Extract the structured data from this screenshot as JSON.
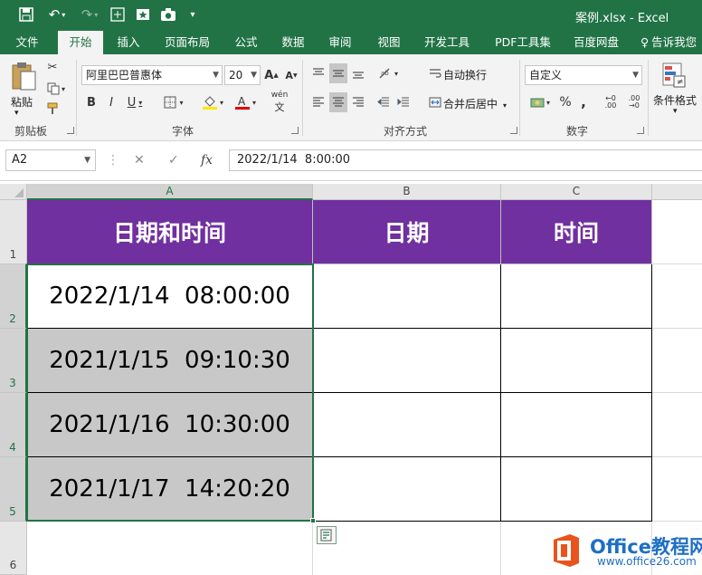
{
  "window": {
    "title": "案例.xlsx - Excel"
  },
  "ribbon_tabs": [
    "文件",
    "开始",
    "插入",
    "页面布局",
    "公式",
    "数据",
    "审阅",
    "视图",
    "开发工具",
    "PDF工具集",
    "百度网盘",
    "告诉我您"
  ],
  "clipboard": {
    "paste_label": "粘贴",
    "group_label": "剪贴板"
  },
  "font": {
    "name": "阿里巴巴普惠体",
    "size": "20",
    "group_label": "字体",
    "grow": "A",
    "shrink": "A",
    "bold": "B",
    "italic": "I",
    "underline": "U",
    "phonetic": "wén"
  },
  "alignment": {
    "wrap_text": "自动换行",
    "merge_center": "合并后居中",
    "group_label": "对齐方式"
  },
  "number": {
    "format": "自定义",
    "group_label": "数字",
    "percent": "%",
    "comma": ","
  },
  "styles": {
    "conditional_format": "条件格式"
  },
  "formula_bar": {
    "name_box": "A2",
    "fx": "fx",
    "value": "2022/1/14  8:00:00"
  },
  "columns": [
    "A",
    "B",
    "C"
  ],
  "rows": [
    "1",
    "2",
    "3",
    "4",
    "5",
    "6"
  ],
  "table": {
    "headers": [
      "日期和时间",
      "日期",
      "时间"
    ],
    "datetimes": [
      "2022/1/14  08:00:00",
      "2021/1/15  09:10:30",
      "2021/1/16  10:30:00",
      "2021/1/17  14:20:20"
    ]
  },
  "watermark": {
    "brand": "Office教程网",
    "url": "www.office26.com"
  },
  "colors": {
    "excel_green": "#217346",
    "header_purple": "#7030a0",
    "selected_grey": "#c8c8c8"
  }
}
